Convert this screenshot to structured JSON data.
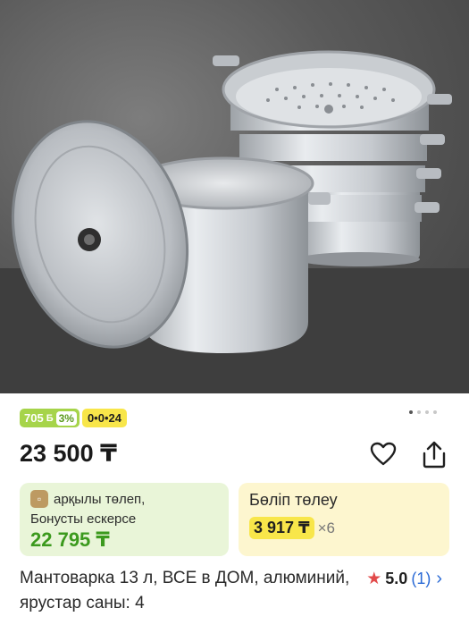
{
  "product": {
    "image_alt": "Aluminium steamer pot with lid and stacked tiers",
    "title": "Мантоварка 13 л, ВСЕ в ДОМ, алюминий, ярустар саны: 4",
    "price": "23 500 ₸"
  },
  "badges": {
    "bonus_amount": "705",
    "bonus_icon": "Б",
    "bonus_percent": "3%",
    "installment": "0•0•24"
  },
  "carousel": {
    "dots": 4,
    "active": 0
  },
  "actions": {
    "favorite_icon": "heart-icon",
    "share_icon": "share-icon"
  },
  "bonus_card": {
    "pay_label": "арқылы төлеп,",
    "bonus_label": "Бонусты ескерсе",
    "amount": "22 795 ₸",
    "brand_icon": "bag-icon"
  },
  "installment_card": {
    "title": "Бөліп төлеу",
    "amount": "3 917 ₸",
    "multiplier": "×6"
  },
  "rating": {
    "value": "5.0",
    "count": "(1)",
    "star_color": "#e24a4a"
  },
  "colors": {
    "bonus_green": "#a6d44a",
    "installment_yellow": "#f8e64a",
    "link_blue": "#2a6ad6"
  }
}
